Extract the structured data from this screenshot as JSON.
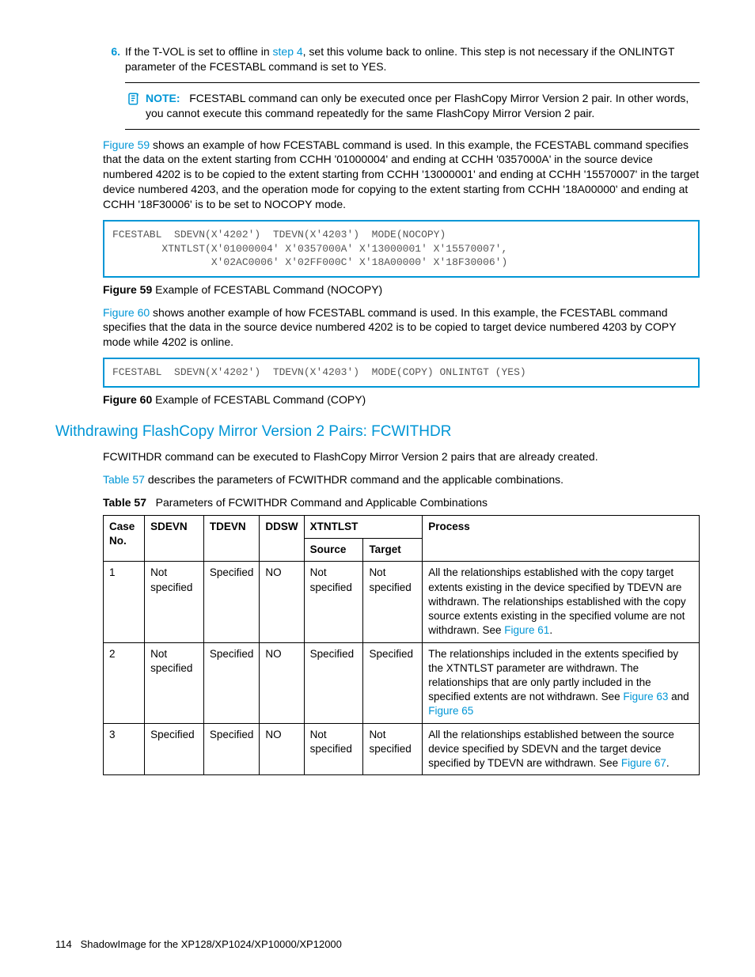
{
  "step6": {
    "num": "6.",
    "text_a": "If the T-VOL is set to offline in ",
    "link": "step 4",
    "text_b": ", set this volume back to online. This step is not necessary if the ONLINTGT parameter of the FCESTABL command is set to YES."
  },
  "note": {
    "label": "NOTE:",
    "body": "FCESTABL command can only be executed once per FlashCopy Mirror Version 2 pair. In other words, you cannot execute this command repeatedly for the same FlashCopy Mirror Version 2 pair."
  },
  "para1": {
    "link": "Figure 59",
    "text": " shows an example of how FCESTABL command is used. In this example, the FCESTABL command specifies that the data on the extent starting from CCHH '01000004' and ending at CCHH '0357000A' in the source device numbered 4202 is to be copied to the extent starting from CCHH '13000001' and ending at CCHH '15570007' in the target device numbered 4203, and the operation mode for copying to the extent starting from CCHH '18A00000' and ending at CCHH '18F30006' is to be set to NOCOPY mode."
  },
  "code1": "FCESTABL  SDEVN(X'4202')  TDEVN(X'4203')  MODE(NOCOPY)\n        XTNTLST(X'01000004' X'0357000A' X'13000001' X'15570007',\n                X'02AC0006' X'02FF000C' X'18A00000' X'18F30006')",
  "fig59": {
    "label": "Figure 59",
    "text": " Example of FCESTABL Command (NOCOPY)"
  },
  "para2": {
    "link": "Figure 60",
    "text": " shows another example of how FCESTABL command is used. In this example, the FCESTABL command specifies that the data in the source device numbered 4202 is to be copied to target device numbered 4203 by COPY mode while 4202 is online."
  },
  "code2": "FCESTABL  SDEVN(X'4202')  TDEVN(X'4203')  MODE(COPY) ONLINTGT (YES)",
  "fig60": {
    "label": "Figure 60",
    "text": " Example of FCESTABL Command (COPY)"
  },
  "section_heading": "Withdrawing FlashCopy Mirror Version 2 Pairs: FCWITHDR",
  "section_p1": "FCWITHDR command can be executed to FlashCopy Mirror Version 2 pairs that are already created.",
  "section_p2": {
    "link": "Table 57",
    "text": " describes the parameters of FCWITHDR command and the applicable combinations."
  },
  "table_title": {
    "label": "Table 57",
    "text": "Parameters of FCWITHDR Command and Applicable Combinations"
  },
  "thead": {
    "case": "Case No.",
    "sdevn": "SDEVN",
    "tdevn": "TDEVN",
    "ddsw": "DDSW",
    "xtntlst": "XTNTLST",
    "src": "Source",
    "tgt": "Target",
    "process": "Process"
  },
  "rows": [
    {
      "case": "1",
      "sdevn": "Not specified",
      "tdevn": "Specified",
      "ddsw": "NO",
      "src": "Not specified",
      "tgt": "Not specified",
      "proc_a": "All the relationships established with the copy target extents existing in the device specified by TDEVN are withdrawn. The relationships established with the copy source extents existing in the specified volume are not withdrawn. See ",
      "proc_links": [
        {
          "t": "Figure 61"
        }
      ],
      "proc_tail": "."
    },
    {
      "case": "2",
      "sdevn": "Not specified",
      "tdevn": "Specified",
      "ddsw": "NO",
      "src": "Specified",
      "tgt": "Specified",
      "proc_a": "The relationships included in the extents specified by the XTNTLST parameter are withdrawn. The relationships that are only partly included in the specified extents are not withdrawn. See ",
      "proc_links": [
        {
          "t": "Figure 63"
        },
        {
          "sep": " and ",
          "t": "Figure 65"
        }
      ],
      "proc_tail": ""
    },
    {
      "case": "3",
      "sdevn": "Specified",
      "tdevn": "Specified",
      "ddsw": "NO",
      "src": "Not specified",
      "tgt": "Not specified",
      "proc_a": "All the relationships established between the source device specified by SDEVN and the target device specified by TDEVN are withdrawn. See ",
      "proc_links": [
        {
          "t": "Figure 67"
        }
      ],
      "proc_tail": "."
    }
  ],
  "footer": {
    "page": "114",
    "title": "ShadowImage for the XP128/XP1024/XP10000/XP12000"
  }
}
